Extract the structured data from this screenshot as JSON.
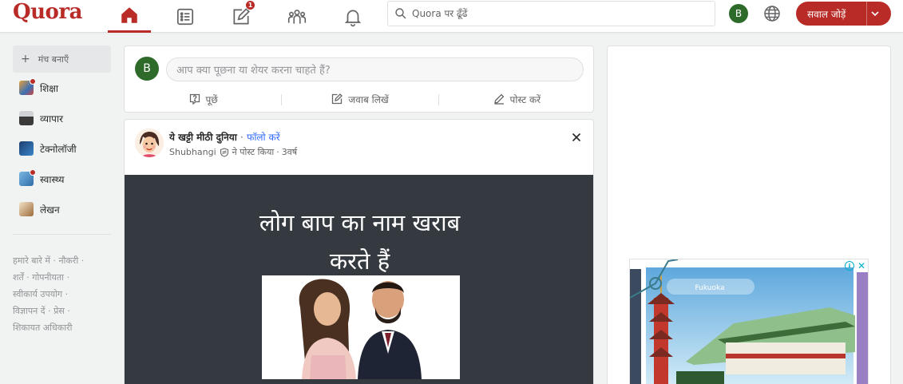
{
  "header": {
    "logo": "Quora",
    "notifications_badge": "1",
    "search_placeholder": "Quora पर ढूँढें",
    "user_initial": "B",
    "add_question_label": "सवाल जोड़ें",
    "brand_color": "#b92b27"
  },
  "sidebar": {
    "create_space_label": "मंच बनाएँ",
    "topics": [
      {
        "label": "शिक्षा",
        "has_dot": true
      },
      {
        "label": "व्यापार",
        "has_dot": false
      },
      {
        "label": "टेक्नोलॉजी",
        "has_dot": false
      },
      {
        "label": "स्वास्थ्य",
        "has_dot": true
      },
      {
        "label": "लेखन",
        "has_dot": false
      }
    ],
    "footer_links": [
      "हमारे बारे में",
      "नौकरी",
      "शर्तें",
      "गोपनीयता",
      "स्वीकार्य उपयोग",
      "विज्ञापन दें",
      "प्रेस",
      "शिकायत अधिकारी"
    ]
  },
  "ask_box": {
    "user_initial": "B",
    "placeholder": "आप क्या पूछना या शेयर करना चाहते हैं?",
    "actions": {
      "ask": "पूछें",
      "answer": "जवाब लिखें",
      "post": "पोस्ट करें"
    }
  },
  "post": {
    "space_name": "ये खट्टी मीठी दुनिया",
    "separator": "·",
    "follow_label": "फॉलो करें",
    "author": "Shubhangi",
    "posted_text": "ने पोस्ट किया",
    "age": "3वर्ष",
    "meme_line1": "लोग बाप का नाम खराब",
    "meme_line2": "करते हैं"
  },
  "ad": {
    "caption": "Fukuoka"
  }
}
